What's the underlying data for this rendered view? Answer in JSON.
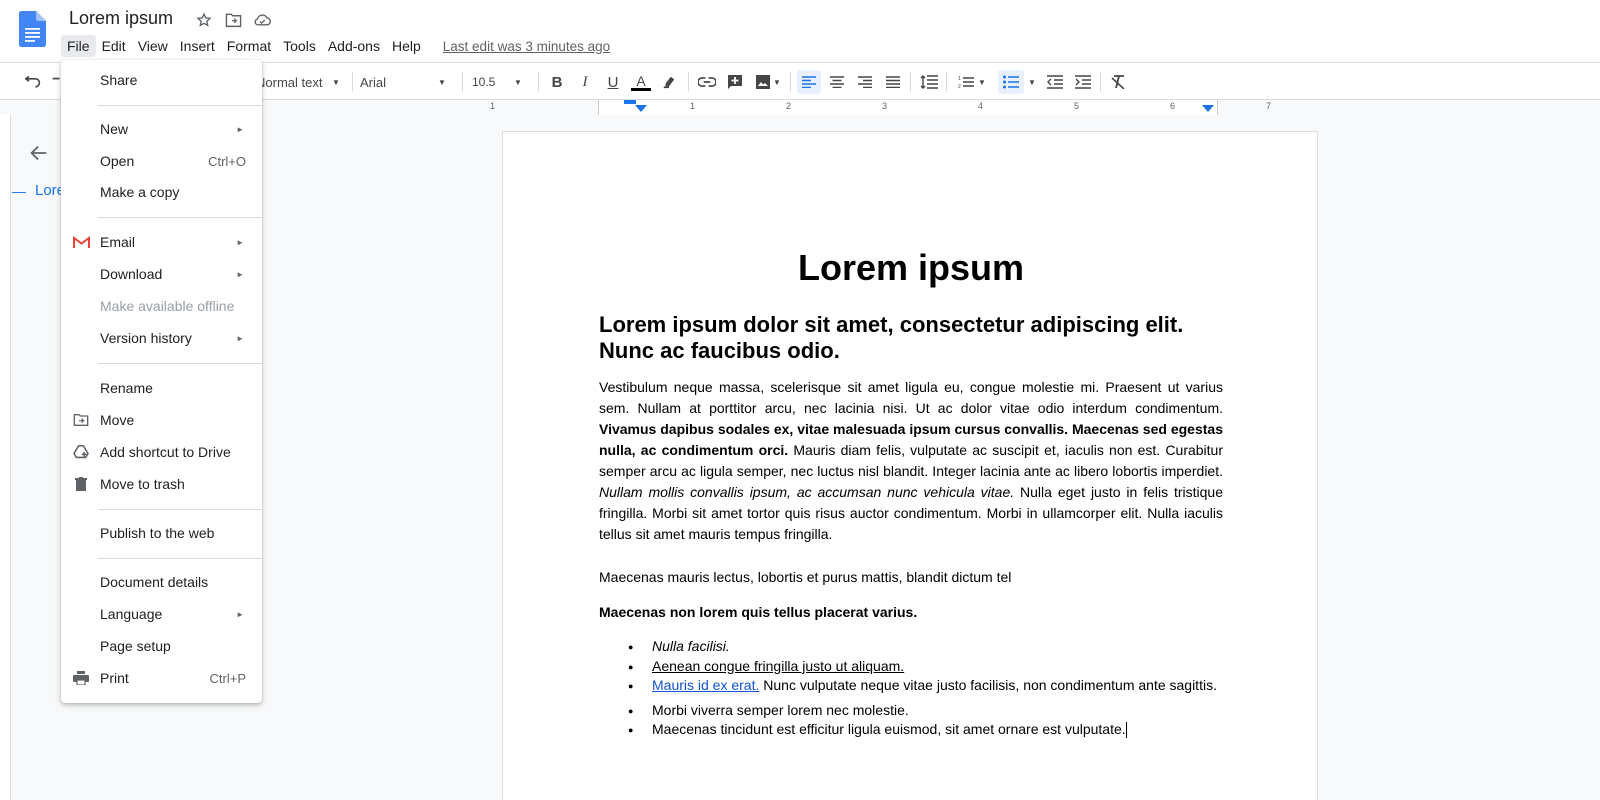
{
  "header": {
    "title": "Lorem ipsum",
    "last_edit": "Last edit was 3 minutes ago",
    "menus": [
      "File",
      "Edit",
      "View",
      "Insert",
      "Format",
      "Tools",
      "Add-ons",
      "Help"
    ]
  },
  "toolbar": {
    "style": "Normal text",
    "font": "Arial",
    "size": "10.5",
    "accent_color": "#1a73e8"
  },
  "ruler": {
    "numbers": [
      "1",
      "1",
      "2",
      "3",
      "4",
      "5",
      "6",
      "7"
    ]
  },
  "outline": {
    "item": "Lore"
  },
  "document": {
    "title": "Lorem ipsum",
    "heading": "Lorem ipsum dolor sit amet, consectetur adipiscing elit. Nunc ac faucibus odio.",
    "p1_a": "Vestibulum neque massa, scelerisque sit amet ligula eu, congue molestie mi. Praesent ut varius sem. Nullam at porttitor arcu, nec lacinia nisi. Ut ac dolor vitae odio interdum condimentum. ",
    "p1_bold": "Vivamus dapibus sodales ex, vitae malesuada ipsum cursus convallis. Maecenas sed egestas nulla, ac condimentum orci.",
    "p1_b": " Mauris diam felis, vulputate ac suscipit et, iaculis non est. Curabitur semper arcu ac ligula semper, nec luctus nisl blandit. Integer lacinia ante ac libero lobortis imperdiet. ",
    "p1_italic": "Nullam mollis convallis ipsum, ac accumsan nunc vehicula vitae.",
    "p1_c": " Nulla eget justo in felis tristique fringilla. Morbi sit amet tortor quis risus auctor condimentum. Morbi in ullamcorper elit. Nulla iaculis tellus sit amet mauris tempus fringilla.",
    "p2": "Maecenas mauris lectus, lobortis et purus mattis, blandit dictum tel",
    "p3": "Maecenas non lorem quis tellus placerat varius.",
    "list": {
      "item1": "Nulla facilisi.",
      "item2": "Aenean congue fringilla justo ut aliquam.",
      "item3_link": "Mauris id ex erat.",
      "item3_rest": " Nunc vulputate neque vitae justo facilisis, non condimentum ante sagittis.",
      "item4": "Morbi viverra semper lorem nec molestie.",
      "item5": "Maecenas tincidunt est efficitur ligula euismod, sit amet ornare est vulputate."
    }
  },
  "file_menu": {
    "share": "Share",
    "new": "New",
    "open": "Open",
    "open_shortcut": "Ctrl+O",
    "make_copy": "Make a copy",
    "email": "Email",
    "download": "Download",
    "offline": "Make available offline",
    "version_history": "Version history",
    "rename": "Rename",
    "move": "Move",
    "add_shortcut": "Add shortcut to Drive",
    "trash": "Move to trash",
    "publish": "Publish to the web",
    "details": "Document details",
    "language": "Language",
    "page_setup": "Page setup",
    "print": "Print",
    "print_shortcut": "Ctrl+P"
  }
}
